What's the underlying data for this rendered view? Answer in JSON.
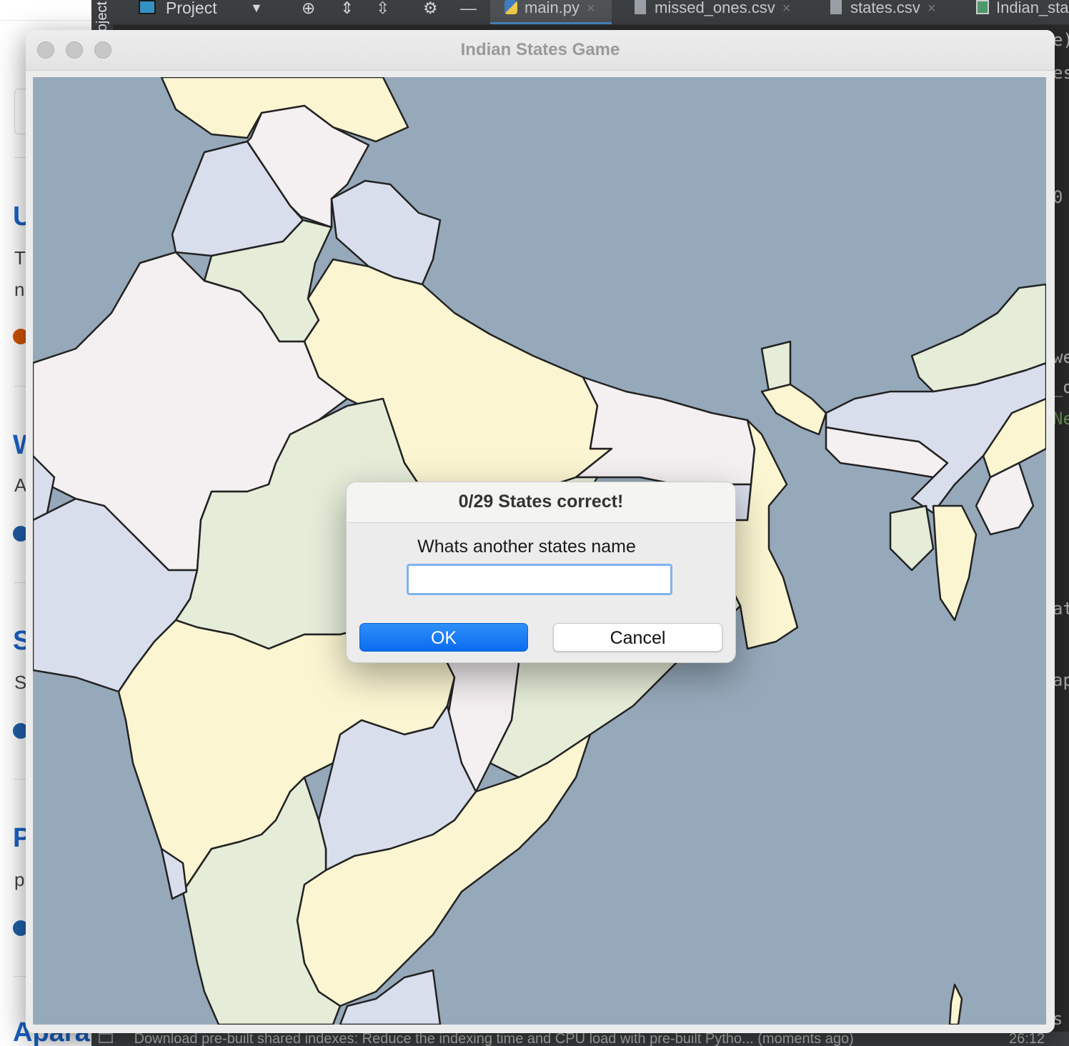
{
  "background_page": {
    "headings": [
      "U",
      "W",
      "S",
      "P",
      "Apara"
    ],
    "snippets": [
      "T",
      "n",
      "A",
      "S",
      "p"
    ],
    "dot_colors": [
      "#d35400",
      "#1f5fa8",
      "#1f5fa8",
      "#1f5fa8"
    ]
  },
  "ide": {
    "sidebar_label": "Project",
    "toolbar": {
      "project_label": "Project"
    },
    "tabs": [
      {
        "label": "main.py",
        "icon": "python-file-icon",
        "active": true
      },
      {
        "label": "missed_ones.csv",
        "icon": "text-file-icon",
        "active": false
      },
      {
        "label": "states.csv",
        "icon": "text-file-icon",
        "active": false
      },
      {
        "label": "Indian_sta",
        "icon": "image-file-icon",
        "active": false
      }
    ],
    "code_peek": [
      "e)",
      "es",
      "0",
      "we",
      "_d",
      "Ne",
      "at",
      "ap",
      "s"
    ],
    "status_text": "Download pre-built shared indexes: Reduce the indexing time and CPU load with pre-built Pytho... (moments ago)",
    "status_time": "26:12"
  },
  "game_window": {
    "title": "Indian States Game",
    "map": {
      "sea_color": "#96a9ba",
      "state_colors": [
        "#fbf5d1",
        "#f4eff0",
        "#d9deed",
        "#e5ecd8"
      ]
    }
  },
  "dialog": {
    "title": "0/29 States correct!",
    "prompt": "Whats another states name",
    "input_value": "",
    "ok_label": "OK",
    "cancel_label": "Cancel"
  }
}
